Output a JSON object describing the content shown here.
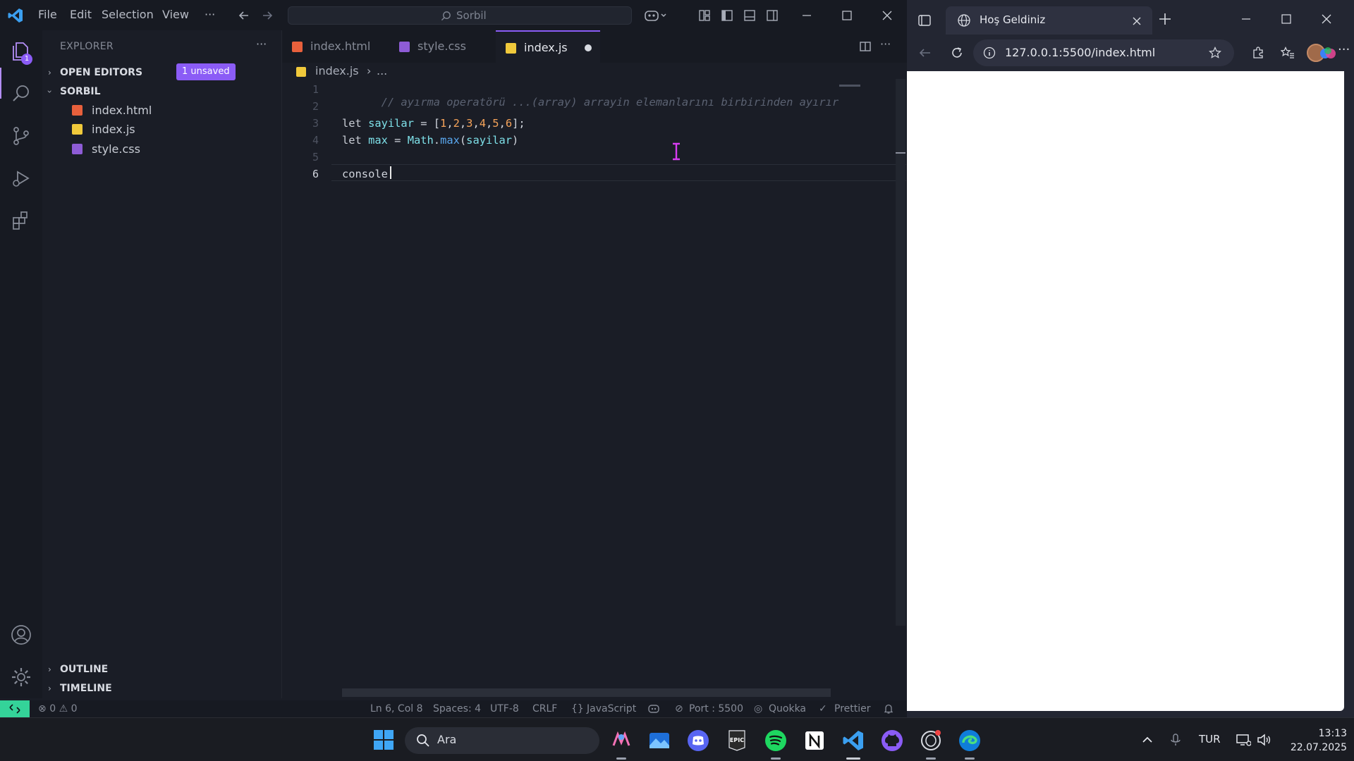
{
  "vscode": {
    "menu": [
      "File",
      "Edit",
      "Selection",
      "View",
      "···"
    ],
    "search_text": "Sorbil",
    "activity_badge": "1",
    "explorer_title": "EXPLORER",
    "open_editors_label": "OPEN EDITORS",
    "unsaved_badge": "1 unsaved",
    "folder_label": "SORBIL",
    "files": [
      "index.html",
      "index.js",
      "style.css"
    ],
    "outline_label": "OUTLINE",
    "timeline_label": "TIMELINE",
    "tabs": [
      "index.html",
      "style.css",
      "index.js"
    ],
    "breadcrumb": {
      "file": "index.js",
      "rest": "..."
    },
    "line_numbers": [
      "1",
      "2",
      "3",
      "4",
      "5",
      "6"
    ],
    "code": {
      "line1_comment": "// ayırma operatörü ...(array) arrayin elemanlarını birbirinden ayırır",
      "line3": {
        "kw": "let",
        "var": "sayilar",
        "eq": " = [",
        "nums": [
          "1",
          "2",
          "3",
          "4",
          "5",
          "6"
        ],
        "tail": "];"
      },
      "line4": {
        "kw": "let",
        "var": "max",
        "eq": " = ",
        "obj": "Math",
        "dot": ".",
        "fn": "max",
        "open": "(",
        "arg": "sayilar",
        "close": ")"
      },
      "line6": "console"
    },
    "status": {
      "errors": "0",
      "warnings": "0",
      "position": "Ln 6, Col 8",
      "spaces": "Spaces: 4",
      "encoding": "UTF-8",
      "eol": "CRLF",
      "language": "JavaScript",
      "port": "Port : 5500",
      "quokka": "Quokka",
      "prettier": "Prettier"
    },
    "colors": {
      "accent": "#8b5cf6",
      "remote": "#34d399",
      "html": "#e8603c",
      "js": "#f0c93b",
      "css": "#8e5cd6"
    }
  },
  "browser": {
    "tab_title": "Hoş Geldiniz",
    "url": "127.0.0.1:5500/index.html"
  },
  "taskbar": {
    "search_label": "Ara",
    "language": "TUR",
    "time": "13:13",
    "date": "22.07.2025"
  }
}
